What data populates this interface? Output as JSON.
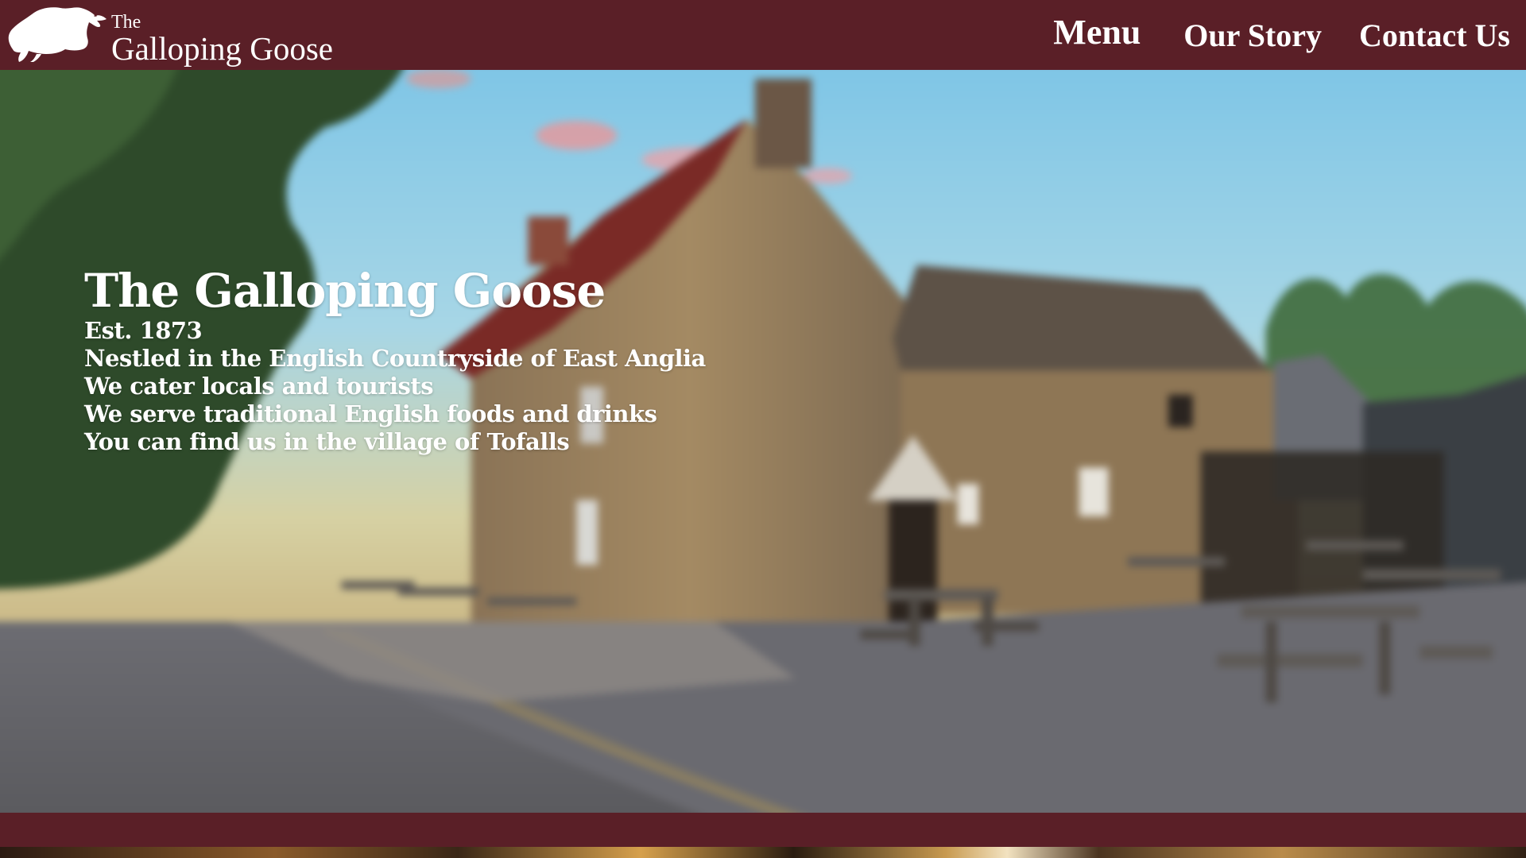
{
  "header": {
    "logo_small": "The",
    "logo_name": "Galloping Goose",
    "logo_icon": "goose-logo-icon",
    "nav": [
      {
        "label": "Menu"
      },
      {
        "label": "Our Story"
      },
      {
        "label": "Contact Us"
      }
    ]
  },
  "hero": {
    "title": "The Galloping Goose",
    "lines": [
      "Est. 1873",
      "Nestled in the English Countryside of East Anglia",
      "We cater locals and tourists",
      "We serve traditional English foods and drinks",
      "You can find us in the village of Tofalls"
    ],
    "image_subject": "stone-pub-photo"
  },
  "colors": {
    "brand": "#5a1f27",
    "text": "#ffffff"
  }
}
